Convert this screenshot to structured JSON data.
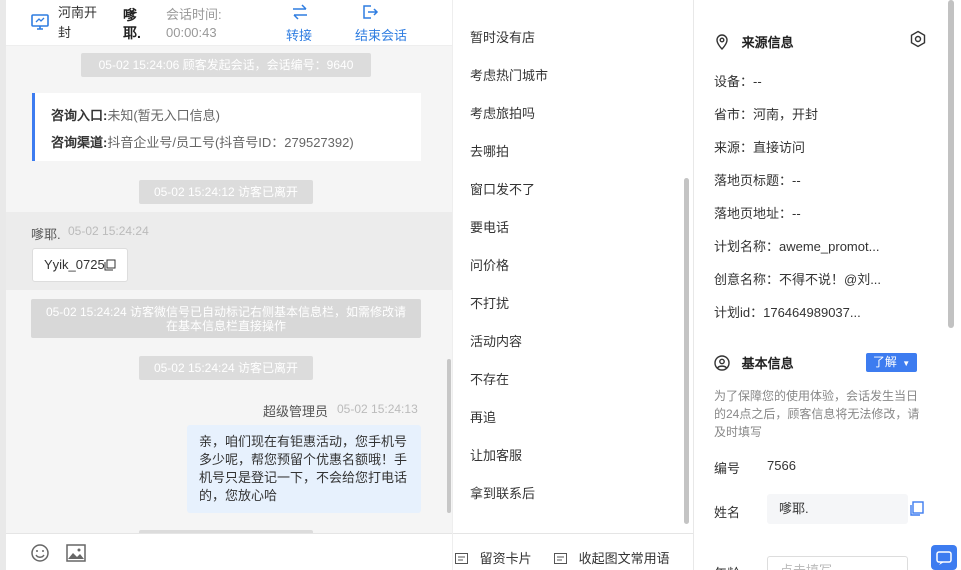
{
  "header": {
    "region": "河南开封",
    "visitor_name": "嗲耶.",
    "session_time_label": "会话时间:",
    "session_time_value": "00:00:43",
    "transfer_label": "转接",
    "end_label": "结束会话"
  },
  "chat": {
    "sys_start": "05-02 15:24:06 顾客发起会话，会话编号：9640",
    "source_card": {
      "entry_label": "咨询入口:",
      "entry_value": "未知(暂无入口信息)",
      "channel_label": "咨询渠道:",
      "channel_value": "抖音企业号/员工号(抖音号ID：279527392)"
    },
    "sys_leave_1": "05-02 15:24:12 访客已离开",
    "visitor": {
      "name": "嗲耶.",
      "time": "05-02 15:24:24",
      "wechat": "Yyik_0725"
    },
    "sys_wechat_note": "05-02 15:24:24 访客微信号已自动标记右侧基本信息栏，如需修改请在基本信息栏直接操作",
    "sys_leave_2": "05-02 15:24:24 访客已离开",
    "admin": {
      "name": "超级管理员",
      "time": "05-02 15:24:13",
      "message": "亲，咱们现在有钜惠活动，您手机号多少呢，帮您预留个优惠名额哦！手机号只是登记一下，不会给您打电话的，您放心哈"
    }
  },
  "quick_replies": [
    "暂时没有店",
    "考虑热门城市",
    "考虑旅拍吗",
    "去哪拍",
    "窗口发不了",
    "要电话",
    "问价格",
    "不打扰",
    "活动内容",
    "不存在",
    "再追",
    "让加客服",
    "拿到联系后"
  ],
  "reply_footer": {
    "card_label": "留资卡片",
    "collect_label": "收起图文常用语"
  },
  "source_info": {
    "title": "来源信息",
    "device": "设备：--",
    "province_city": "省市：河南，开封",
    "source": "来源：直接访问",
    "landing_title": "落地页标题：--",
    "landing_url": "落地页地址：--",
    "plan_name": "计划名称：aweme_promot...",
    "creative_name": "创意名称：不得不说！@刘...",
    "plan_id": "计划id：176464989037..."
  },
  "basic_info": {
    "title": "基本信息",
    "know_label": "了解",
    "notice": "为了保障您的使用体验，会话发生当日的24点之后，顾客信息将无法修改，请及时填写",
    "id_label": "编号",
    "id_value": "7566",
    "name_label": "姓名",
    "name_value": "嗲耶.",
    "age_label": "年龄",
    "age_placeholder": "点击填写"
  },
  "icons": {
    "header_device": "monitor-icon",
    "transfer": "swap-arrows-icon",
    "end": "exit-icon",
    "copy": "copy-icon",
    "emoji": "smile-icon",
    "image": "image-icon",
    "location": "location-pin-icon",
    "settings": "settings-icon",
    "user": "user-circle-icon"
  },
  "colors": {
    "accent": "#2f7de1",
    "primary_button": "#3d7cf0",
    "bubble": "#e7f1fd"
  }
}
